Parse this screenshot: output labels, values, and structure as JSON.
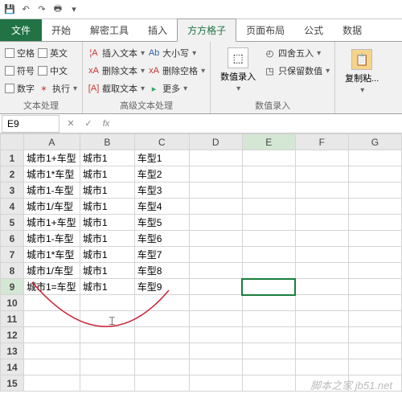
{
  "tabs": {
    "file": "文件",
    "t0": "开始",
    "t1": "解密工具",
    "t2": "插入",
    "t3": "方方格子",
    "t4": "页面布局",
    "t5": "公式",
    "t6": "数据"
  },
  "g1": {
    "c0": "空格",
    "c1": "符号",
    "c2": "数字",
    "c3": "英文",
    "c4": "中文",
    "c5": "执行",
    "label": "文本处理"
  },
  "g2": {
    "r0": "插入文本",
    "r1": "删除文本",
    "r2": "截取文本",
    "label": "高级文本处理"
  },
  "g3": {
    "r0": "大小写",
    "r1": "删除空格",
    "r2": "更多"
  },
  "g4": {
    "btn": "数值录入",
    "label": "数值录入"
  },
  "g5": {
    "r0": "四舍五入",
    "r1": "只保留数值"
  },
  "g6": {
    "btn": "复制粘..."
  },
  "namebox": "E9",
  "fx": "fx",
  "cols": [
    "A",
    "B",
    "C",
    "D",
    "E",
    "F",
    "G"
  ],
  "rows": [
    "1",
    "2",
    "3",
    "4",
    "5",
    "6",
    "7",
    "8",
    "9",
    "10",
    "11",
    "12",
    "13",
    "14",
    "15"
  ],
  "cells": {
    "A1": "城市1+车型",
    "B1": "城市1",
    "C1": "车型1",
    "A2": "城市1*车型",
    "B2": "城市1",
    "C2": "车型2",
    "A3": "城市1-车型",
    "B3": "城市1",
    "C3": "车型3",
    "A4": "城市1/车型",
    "B4": "城市1",
    "C4": "车型4",
    "A5": "城市1+车型",
    "B5": "城市1",
    "C5": "车型5",
    "A6": "城市1-车型",
    "B6": "城市1",
    "C6": "车型6",
    "A7": "城市1*车型",
    "B7": "城市1",
    "C7": "车型7",
    "A8": "城市1/车型",
    "B8": "城市1",
    "C8": "车型8",
    "A9": "城市1=车型",
    "B9": "城市1",
    "C9": "车型9"
  },
  "watermark": "脚本之家 jb51.net",
  "meta_ab": "Ab",
  "meta_chevd": "▾",
  "meta_chevr": "▸"
}
